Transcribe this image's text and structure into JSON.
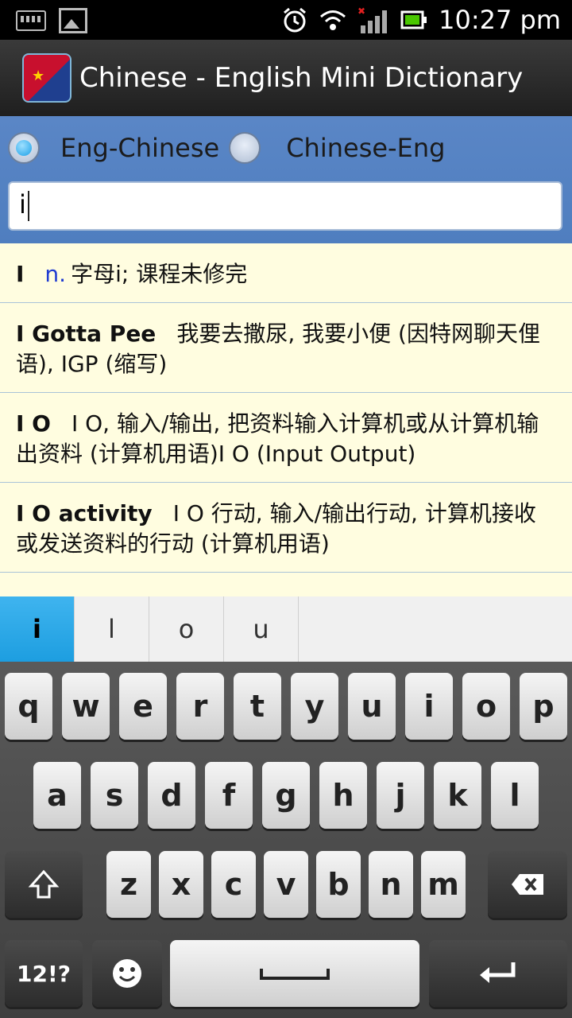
{
  "status_bar": {
    "time": "10:27 pm"
  },
  "app": {
    "title": "Chinese - English Mini Dictionary"
  },
  "mode": {
    "options": [
      {
        "label": "Eng-Chinese",
        "selected": true
      },
      {
        "label": "Chinese-Eng",
        "selected": false
      }
    ]
  },
  "search": {
    "value": "i"
  },
  "results": [
    {
      "word": "I",
      "pos": "n.",
      "definition": "字母i; 课程未修完"
    },
    {
      "word": "I Gotta Pee",
      "pos": "",
      "definition": "我要去撒尿, 我要小便 (因特网聊天俚语), IGP (缩写)"
    },
    {
      "word": "I O",
      "pos": "",
      "definition": "I O, 输入/输出, 把资料输入计算机或从计算机输出资料 (计算机用语)I O (Input Output)"
    },
    {
      "word": "I O activity",
      "pos": "",
      "definition": "I O 行动, 输入/输出行动, 计算机接收或发送资料的行动 (计算机用语)"
    }
  ],
  "suggestions": [
    "i",
    "l",
    "o",
    "u"
  ],
  "keyboard": {
    "row1": [
      "q",
      "w",
      "e",
      "r",
      "t",
      "y",
      "u",
      "i",
      "o",
      "p"
    ],
    "row2": [
      "a",
      "s",
      "d",
      "f",
      "g",
      "h",
      "j",
      "k",
      "l"
    ],
    "row3": [
      "z",
      "x",
      "c",
      "v",
      "b",
      "n",
      "m"
    ],
    "symbols_label": "12!?"
  },
  "colors": {
    "accent": "#1d9ee0",
    "results_bg": "#fffde0",
    "radio_bar": "#5a86c6"
  }
}
